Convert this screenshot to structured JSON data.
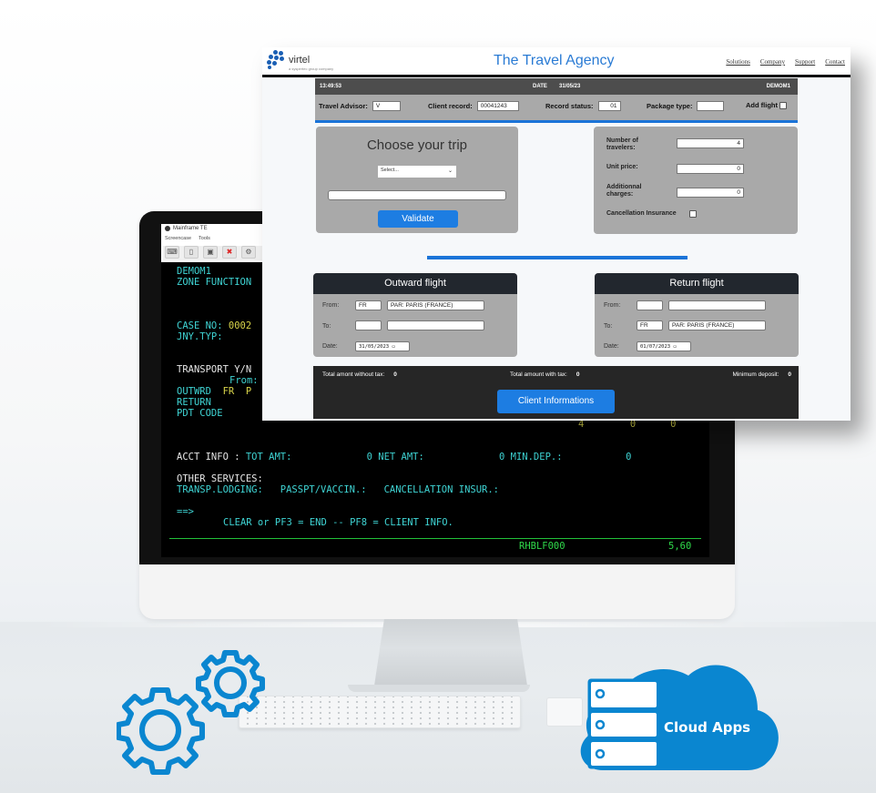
{
  "terminal": {
    "window_title": "Mainframe TE",
    "menu": [
      "Screencase",
      "Tools"
    ],
    "lines": {
      "l1": "DEMOM1",
      "l2": "ZONE FUNCTION",
      "case_label": "CASE NO: ",
      "case_value": "0002",
      "jny": "JNY.TYP:",
      "transport": "TRANSPORT Y/N",
      "from": "From:",
      "outwrd_label": "OUTWRD  ",
      "outwrd_value": "FR  P",
      "return": "RETURN",
      "pdt": "PDT CODE",
      "nums": "4        0      0",
      "acct_label": "ACCT INFO : ",
      "acct_rest": "TOT AMT:             0 NET AMT:             0 MIN.DEP.:           0",
      "other": "OTHER SERVICES:",
      "services": "TRANSP.LODGING:   PASSPT/VACCIN.:   CANCELLATION INSUR.:",
      "prompt": "==>",
      "keys": "CLEAR or PF3 = END -- PF8 = CLIENT INFO.",
      "program": "RHBLF000",
      "cursor": "5,60"
    }
  },
  "web": {
    "logo_name": "virtel",
    "logo_sub": "a syspertec group company",
    "title": "The Travel Agency",
    "nav": [
      "Solutions",
      "Company",
      "Support",
      "Contact"
    ],
    "status": {
      "time": "13:49:53",
      "date_label": "DATE",
      "date": "31/05/23",
      "user": "DEMOM1"
    },
    "fields": {
      "advisor_label": "Travel Advisor:",
      "advisor_value": "V",
      "client_label": "Client record:",
      "client_value": "00041243",
      "status_label": "Record status:",
      "status_value": "01",
      "package_label": "Package type:",
      "package_value": "",
      "add_flight_label": "Add flight"
    },
    "choose": {
      "title": "Choose your trip",
      "select_value": "Select...",
      "validate": "Validate"
    },
    "calc": {
      "travelers_label": "Number of travelers:",
      "travelers_value": "4",
      "unit_label": "Unit price:",
      "unit_value": "0",
      "charges_label": "Additionnal charges:",
      "charges_value": "0",
      "insurance_label": "Cancellation Insurance"
    },
    "outward": {
      "title": "Outward flight",
      "from_label": "From:",
      "from_code": "FR",
      "from_city": "PAR: PARIS (FRANCE)",
      "to_label": "To:",
      "to_code": "",
      "to_city": "",
      "date_label": "Date:",
      "date": "31/05/2023"
    },
    "return": {
      "title": "Return flight",
      "from_label": "From:",
      "from_code": "",
      "from_city": "",
      "to_label": "To:",
      "to_code": "FR",
      "to_city": "PAR: PARIS (FRANCE)",
      "date_label": "Date:",
      "date": "01/07/2023"
    },
    "totals": {
      "without_tax_label": "Total amont without tax:",
      "without_tax": "0",
      "with_tax_label": "Total amount with tax:",
      "with_tax": "0",
      "deposit_label": "Minimum deposit:",
      "deposit": "0",
      "client_button": "Client Informations"
    }
  },
  "badges": {
    "cloud_label": "Cloud Apps"
  },
  "colors": {
    "accent": "#1d7de2",
    "icon_blue": "#0a86d0",
    "terminal_cyan": "#3fd4d4",
    "terminal_yellow": "#d8d44a",
    "terminal_green": "#2fd84a"
  }
}
